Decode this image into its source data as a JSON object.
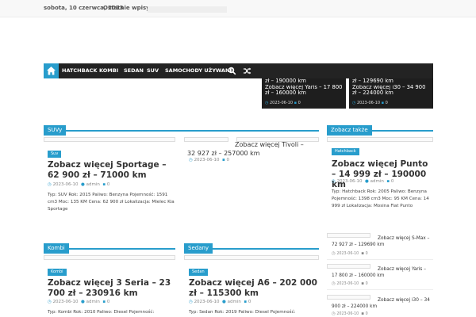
{
  "topbar": {
    "date": "sobota, 10 czerwca, 2023",
    "latest_label": "Ostatnie wpisy:"
  },
  "nav": {
    "items": [
      "HATCHBACK",
      "KOMBI",
      "SEDAN",
      "SUV",
      "SAMOCHODY UŻYWANE"
    ]
  },
  "slider": [
    {
      "line1": "zł – 190000 km",
      "line2": "Zobacz więcej Yaris – 17 800 zł – 160000 km",
      "date": "2023-06-10",
      "comments": "0"
    },
    {
      "line1": "zł – 129690 km",
      "line2": "Zobacz więcej i30 – 34 900 zł – 224000 km",
      "date": "2023-06-10",
      "comments": "0"
    }
  ],
  "suv": {
    "heading": "SUVy",
    "featured": {
      "category": "Suv",
      "title": "Zobacz więcej Sportage – 62 900 zł – 71000 km",
      "date": "2023-06-10",
      "author": "admin",
      "comments": "0",
      "excerpt": "Typ: SUV Rok: 2015 Paliwo: Benzyna Pojemność: 1591 cm3 Moc: 135 KM Cena: 62 900 zł Lokalizacja: Mielec Kia Sportage"
    },
    "side": {
      "title": "Zobacz więcej Tivoli – 32 927 zł – 257000 km",
      "date": "2023-06-10",
      "comments": "0"
    }
  },
  "kombi": {
    "heading": "Kombi",
    "category": "Kombi",
    "title": "Zobacz więcej 3 Seria – 23 700 zł – 230916 km",
    "date": "2023-06-10",
    "author": "admin",
    "comments": "0",
    "excerpt": "Typ: Kombi Rok: 2010 Paliwo: Diesel Pojemność:"
  },
  "sedany": {
    "heading": "Sedany",
    "category": "Sedan",
    "title": "Zobacz więcej A6 – 202 000 zł – 115300 km",
    "date": "2023-06-10",
    "author": "admin",
    "comments": "0",
    "excerpt": "Typ: Sedan Rok: 2019 Paliwo: Diesel Pojemność:"
  },
  "sidebar": {
    "heading": "Zobacz także",
    "featured": {
      "category": "Hatchback",
      "title": "Zobacz więcej Punto – 14 999 zł – 190000 km",
      "date": "2023-06-10",
      "author": "admin",
      "comments": "0",
      "excerpt": "Typ: Hatchback Rok: 2005 Paliwo: Benzyna Pojemność: 1398 cm3 Moc: 95 KM Cena: 14 999 zł Lokalizacja: Mosina Fiat Punto"
    },
    "items": [
      {
        "title": "Zobacz więcej S-Max – 72 927 zł – 129690 km",
        "date": "2023-06-10",
        "comments": "0"
      },
      {
        "title": "Zobacz więcej Yaris – 17 800 zł – 160000 km",
        "date": "2023-06-10",
        "comments": "0"
      },
      {
        "title": "Zobacz więcej i30 – 34 900 zł – 224000 km",
        "date": "2023-06-10",
        "comments": "0"
      }
    ]
  },
  "colors": {
    "accent": "#289dcc",
    "nav_bg": "#232323"
  }
}
